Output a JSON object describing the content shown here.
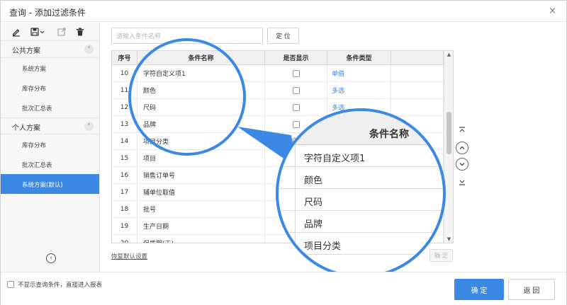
{
  "window": {
    "title": "查询 - 添加过滤条件",
    "close_label": "×"
  },
  "toolbar": {
    "icons": [
      "edit-icon",
      "save-icon",
      "export-icon",
      "delete-icon"
    ]
  },
  "sidebar": {
    "public_group": {
      "label": "公共方案",
      "toggle": "˄"
    },
    "public_items": [
      "系统方案",
      "库存分布",
      "批次汇总表"
    ],
    "personal_group": {
      "label": "个人方案",
      "toggle": "˄"
    },
    "personal_items": [
      "库存分布",
      "批次汇总表",
      "系统方案(默认)"
    ],
    "active_item": "系统方案(默认)",
    "collapse_icon": "‹"
  },
  "search": {
    "placeholder": "请输入条件名称",
    "value": ""
  },
  "locate_label": "定 位",
  "grid": {
    "headers": {
      "no": "序号",
      "name": "条件名称",
      "show": "是否显示",
      "type": "条件类型"
    },
    "rows": [
      {
        "no": "10",
        "name": "字符自定义项1",
        "checked": false,
        "type": "单值"
      },
      {
        "no": "11",
        "name": "颜色",
        "checked": false,
        "type": "多选"
      },
      {
        "no": "12",
        "name": "尺码",
        "checked": false,
        "type": "多选"
      },
      {
        "no": "13",
        "name": "品牌",
        "checked": false,
        "type": ""
      },
      {
        "no": "14",
        "name": "项目分类",
        "checked": false,
        "type": ""
      },
      {
        "no": "15",
        "name": "项目",
        "checked": false,
        "type": ""
      },
      {
        "no": "16",
        "name": "销售订单号",
        "checked": false,
        "type": ""
      },
      {
        "no": "17",
        "name": "辅单位取值",
        "checked": true,
        "type": ""
      },
      {
        "no": "18",
        "name": "批号",
        "checked": true,
        "type": ""
      },
      {
        "no": "19",
        "name": "生产日期",
        "checked": false,
        "type": ""
      },
      {
        "no": "20",
        "name": "保质期(天)",
        "checked": false,
        "type": ""
      }
    ]
  },
  "zoom": {
    "header": "条件名称",
    "rows": [
      "字符自定义项1",
      "颜色",
      "尺码",
      "品牌",
      "项目分类"
    ]
  },
  "restore_label": "恢复默认设置",
  "confirm_small_label": "确 定",
  "footer": {
    "skip_label": "不显示查询条件，直接进入报表",
    "ok_label": "确 定",
    "back_label": "返 回"
  },
  "colors": {
    "accent": "#3b88e5"
  }
}
